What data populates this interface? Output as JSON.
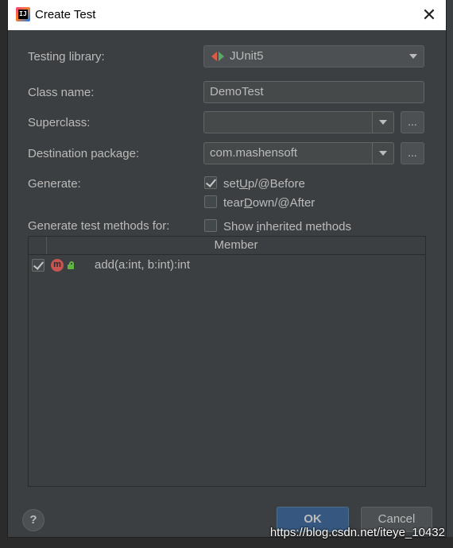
{
  "window": {
    "title": "Create Test",
    "close_glyph": "✕"
  },
  "form": {
    "testing_library": {
      "label": "Testing library:",
      "value": "JUnit5"
    },
    "class_name": {
      "label": "Class name:",
      "value": "DemoTest"
    },
    "superclass": {
      "label": "Superclass:",
      "value": "",
      "browse": "..."
    },
    "destination_package": {
      "label": "Destination package:",
      "value": "com.mashensoft",
      "browse": "..."
    },
    "generate": {
      "label": "Generate:",
      "setup": {
        "pre": "set",
        "u": "U",
        "post": "p/@Before",
        "checked": true
      },
      "teardown": {
        "pre": "tear",
        "u": "D",
        "post": "own/@After",
        "checked": false
      }
    },
    "methods_for": {
      "label": "Generate test methods for:",
      "show_inherited": {
        "pre": "Show ",
        "u": "i",
        "post": "nherited methods",
        "checked": false
      }
    }
  },
  "table": {
    "header": "Member",
    "rows": [
      {
        "checked": true,
        "icon": "method-icon",
        "access": "public-lock-icon",
        "signature": "add(a:int, b:int):int"
      }
    ]
  },
  "buttons": {
    "help": "?",
    "ok": "OK",
    "cancel": "Cancel"
  },
  "watermark": "https://blog.csdn.net/iteye_10432",
  "colors": {
    "background": "#3c3f41",
    "ok_button": "#365880",
    "method_icon": "#c75450",
    "lock_icon": "#62b543"
  }
}
